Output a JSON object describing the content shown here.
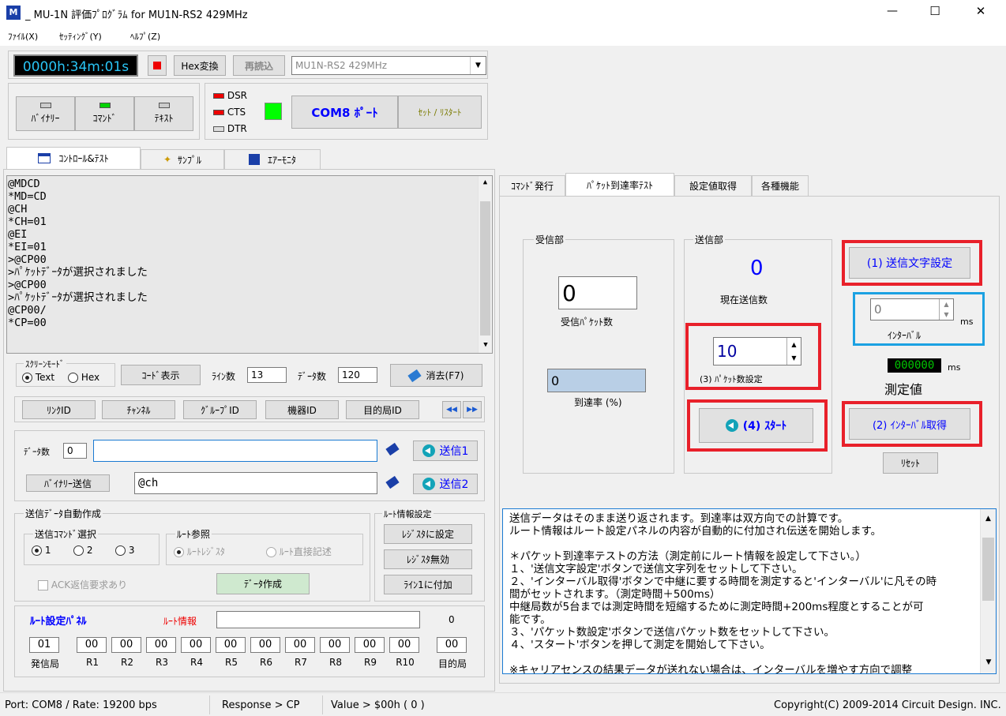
{
  "title_bar": {
    "title": "_ MU-1N 評価ﾌﾟﾛｸﾞﾗﾑ for MU1N-RS2   429MHz",
    "minimize": "—",
    "maximize": "☐",
    "close": "✕"
  },
  "menu": [
    "ﾌｧｲﾙ(X)",
    "ｾｯﾃｨﾝｸﾞ(Y)",
    "ﾍﾙﾌﾟ(Z)"
  ],
  "toolbar": {
    "timer": "0000h:34m:01s",
    "hex_button": "Hex変換",
    "reload_button": "再読込",
    "device_select": "MU1N-RS2     429MHz",
    "mode_binary": "ﾊﾞｲﾅﾘｰ",
    "mode_command": "ｺﾏﾝﾄﾞ",
    "mode_text": "ﾃｷｽﾄ",
    "dsr": "DSR",
    "cts": "CTS",
    "dtr": "DTR",
    "port_button": "COM8 ﾎﾟｰﾄ",
    "reset_button": "ｾｯﾄ / ﾘｽﾀｰﾄ"
  },
  "main_tabs": [
    "ｺﾝﾄﾛｰﾙ&ﾃｽﾄ",
    "ｻﾝﾌﾟﾙ",
    "ｴｱｰﾓﾆﾀ"
  ],
  "log_lines": [
    "@MDCD",
    "*MD=CD",
    "@CH",
    "*CH=01",
    "@EI",
    "*EI=01",
    ">@CP00",
    ">ﾊﾟｹｯﾄﾃﾞｰﾀが選択されました",
    ">@CP00",
    ">ﾊﾟｹｯﾄﾃﾞｰﾀが選択されました",
    "@CP00/",
    "*CP=00"
  ],
  "screen_mode": {
    "label": "ｽｸﾘｰﾝﾓｰﾄﾞ",
    "text": "Text",
    "hex": "Hex",
    "code_button": "ｺｰﾄﾞ表示",
    "lines_label": "ﾗｲﾝ数",
    "lines_value": "13",
    "data_label": "ﾃﾞｰﾀ数",
    "data_value": "120",
    "clear_button": "消去(F7)"
  },
  "id_buttons": [
    "ﾘﾝｸID",
    "ﾁｬﾝﾈﾙ",
    "ｸﾞﾙｰﾌﾟID",
    "機器ID",
    "目的局ID"
  ],
  "send": {
    "data_count_label": "ﾃﾞｰﾀ数",
    "data_count": "0",
    "binary_button": "ﾊﾞｲﾅﾘｰ送信",
    "input2": "@ch",
    "send1": "送信1",
    "send2": "送信2"
  },
  "auto_create": {
    "title": "送信ﾃﾞｰﾀ自動作成",
    "cmd_select": "送信ｺﾏﾝﾄﾞ選択",
    "opt1": "1",
    "opt2": "2",
    "opt3": "3",
    "route_ref": "ﾙｰﾄ参照",
    "route_reg": "ﾙｰﾄﾚｼﾞｽﾀ",
    "route_direct": "ﾙｰﾄ直接記述",
    "ack": "ACK返信要求あり",
    "create_button": "ﾃﾞｰﾀ作成"
  },
  "route_info": {
    "title": "ﾙｰﾄ情報設定",
    "set_button": "ﾚｼﾞｽﾀに設定",
    "disable_button": "ﾚｼﾞｽﾀ無効",
    "append_button": "ﾗｲﾝ1に付加"
  },
  "route_panel": {
    "title": "ﾙｰﾄ設定ﾊﾟﾈﾙ",
    "info_label": "ﾙｰﾄ情報",
    "count": "0",
    "cells": [
      {
        "v": "01",
        "l": "発信局"
      },
      {
        "v": "00",
        "l": "R1"
      },
      {
        "v": "00",
        "l": "R2"
      },
      {
        "v": "00",
        "l": "R3"
      },
      {
        "v": "00",
        "l": "R4"
      },
      {
        "v": "00",
        "l": "R5"
      },
      {
        "v": "00",
        "l": "R6"
      },
      {
        "v": "00",
        "l": "R7"
      },
      {
        "v": "00",
        "l": "R8"
      },
      {
        "v": "00",
        "l": "R9"
      },
      {
        "v": "00",
        "l": "R10"
      },
      {
        "v": "00",
        "l": "目的局"
      }
    ]
  },
  "right_tabs": [
    "ｺﾏﾝﾄﾞ発行",
    "ﾊﾟｹｯﾄ到達率ﾃｽﾄ",
    "設定値取得",
    "各種機能"
  ],
  "receiver": {
    "title": "受信部",
    "count": "0",
    "count_label": "受信ﾊﾟｹｯﾄ数",
    "rate": "0",
    "rate_label": "到達率 (%)"
  },
  "sender": {
    "title": "送信部",
    "count": "0",
    "count_label": "現在送信数",
    "packets": "10",
    "packets_label": "(3) ﾊﾟｹｯﾄ数設定",
    "start_button": "(4) ｽﾀｰﾄ"
  },
  "right_controls": {
    "send_text_button": "(1) 送信文字設定",
    "interval_value": "0",
    "interval_label": "ｲﾝﾀｰﾊﾞﾙ",
    "ms": "ms",
    "measured": "000000",
    "measured_ms": "ms",
    "measured_label": "測定値",
    "get_interval_button": "(2) ｲﾝﾀｰﾊﾞﾙ取得",
    "reset_button": "ﾘｾｯﾄ"
  },
  "info_lines": [
    "送信データはそのまま送り返されます。到達率は双方向での計算です。",
    "ルート情報はルート設定パネルの内容が自動的に付加され伝送を開始します。",
    "",
    "＊パケット到達率テストの方法（測定前にルート情報を設定して下さい。）",
    "１、'送信文字設定'ボタンで送信文字列をセットして下さい。",
    "２、'インターバル取得'ボタンで中継に要する時間を測定すると'インターバル'に凡その時",
    "間がセットされます。（測定時間＋500ms）",
    "中継局数が5台までは測定時間を短縮するために測定時間+200ms程度とすることが可",
    "能です。",
    "３、'パケット数設定'ボタンで送信パケット数をセットして下さい。",
    "４、'スタート'ボタンを押して測定を開始して下さい。",
    "",
    "※キャリアセンスの結果データが送れない場合は、インターバルを増やす方向で調整"
  ],
  "status": {
    "port": "Port: COM8 / Rate: 19200 bps",
    "response": "Response > CP",
    "value": "Value > $00h ( 0 )",
    "copyright": "Copyright(C) 2009-2014 Circuit Design. INC."
  },
  "colors": {
    "timer_bg": "#000000",
    "timer_fg": "#29c4f5",
    "highlight_red": "#e8202a",
    "highlight_blue": "#1ba1e2",
    "led_green": "#00ff00",
    "port_blue": "#0000ff"
  }
}
